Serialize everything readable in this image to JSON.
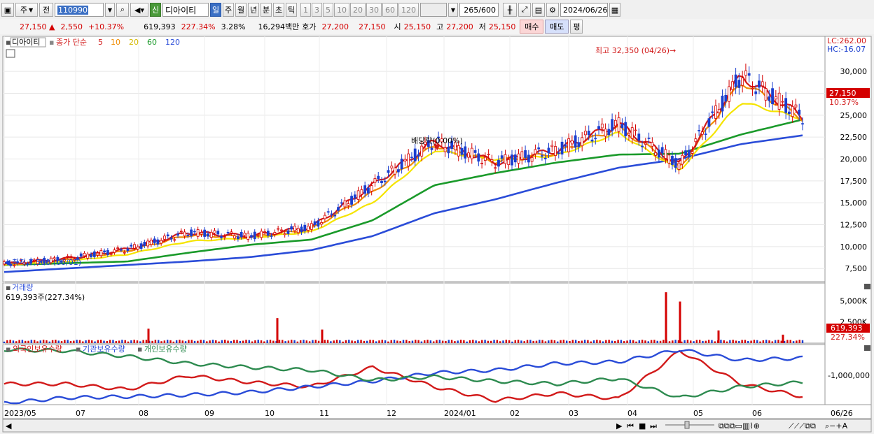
{
  "toolbar": {
    "mode_label": "주",
    "prev_label": "전",
    "code": "110990",
    "shin_label": "신",
    "stock_name": "디아이티",
    "periods": [
      "일",
      "주",
      "월",
      "년",
      "분",
      "초",
      "틱"
    ],
    "period_selected": "일",
    "intervals": [
      "1",
      "3",
      "5",
      "10",
      "20",
      "30",
      "60",
      "120"
    ],
    "count": "265",
    "count_total": "/600",
    "date": "2024/06/26"
  },
  "quote": {
    "price": "27,150",
    "change": "2,550",
    "change_pct": "+10.37%",
    "volume": "619,393",
    "volume_ratio": "227.34%",
    "turnover": "3.28%",
    "amount": "16,294백만",
    "bid_label": "호가",
    "bid1": "27,200",
    "bid2": "27,150",
    "open_label": "시",
    "open": "25,150",
    "high_label": "고",
    "high": "27,200",
    "low_label": "저",
    "low": "25,150",
    "buy_label": "매수",
    "sell_label": "매도",
    "eval_label": "평"
  },
  "price_panel": {
    "stock_tag": "디아이티",
    "ma_title": "종가 단순",
    "ma_periods": [
      "5",
      "10",
      "20",
      "60",
      "120"
    ],
    "ma_colors": [
      "#d21a1a",
      "#f08c00",
      "#f5e400",
      "#1a9a2a",
      "#2a4cd8"
    ],
    "lc": "LC:262.00",
    "hc": "HC:-16.07",
    "high_note": "최고 32,350 (04/26)",
    "low_note": "최저 7,500 (06/01)",
    "dividend_note": "배당락(0.00%)",
    "last_tag": "27,150",
    "last_pct": "10.37%"
  },
  "volume_panel": {
    "title": "거래량",
    "info": "619,393주(227.34%)",
    "last_tag": "619,393",
    "last_pct": "227.34%"
  },
  "holding_panel": {
    "legend": [
      "외국인보유수량",
      "기관보유수량",
      "개인보유수량"
    ],
    "colors": [
      "#d21a1a",
      "#2a4cd8",
      "#2e8b50"
    ]
  },
  "x_axis": {
    "labels": [
      "2023/05",
      "07",
      "08",
      "09",
      "10",
      "11",
      "12",
      "2024/01",
      "02",
      "03",
      "04",
      "05",
      "06"
    ],
    "right_label": "06/26"
  },
  "chart_data": [
    {
      "type": "candlestick",
      "title": "",
      "x": [
        "2023/05",
        "2023/06",
        "2023/07",
        "2023/08",
        "2023/09",
        "2023/10",
        "2023/11",
        "2023/12",
        "2024/01",
        "2024/02",
        "2024/03",
        "2024/04",
        "2024/05",
        "2024/06"
      ],
      "ylim": [
        6000,
        34000
      ],
      "yticks": [
        7500,
        10000,
        12500,
        15000,
        17500,
        20000,
        22500,
        25000,
        27500,
        30000
      ],
      "series": [
        {
          "name": "5",
          "values": [
            8000,
            8600,
            9700,
            11600,
            11200,
            12200,
            17000,
            22000,
            19600,
            21000,
            24000,
            19300,
            29500,
            24800
          ]
        },
        {
          "name": "10",
          "values": [
            7950,
            8500,
            9500,
            11300,
            11100,
            12000,
            16200,
            21600,
            19700,
            20700,
            23600,
            19000,
            28800,
            24600
          ]
        },
        {
          "name": "20",
          "values": [
            7900,
            8300,
            9100,
            10600,
            11000,
            11700,
            15000,
            21000,
            19900,
            20400,
            23000,
            18700,
            26500,
            24600
          ]
        },
        {
          "name": "60",
          "values": [
            7900,
            8100,
            8300,
            9300,
            10200,
            10800,
            13000,
            17000,
            18400,
            19600,
            20500,
            20600,
            22800,
            24500
          ]
        },
        {
          "name": "120",
          "values": [
            7100,
            7500,
            7900,
            8300,
            8800,
            9600,
            11200,
            13800,
            15400,
            17300,
            19000,
            20000,
            21700,
            22700
          ]
        }
      ],
      "annotations": [
        {
          "text": "최고 32,350 (04/26)",
          "value": 32350
        },
        {
          "text": "최저 7,500 (06/01)",
          "value": 7500
        },
        {
          "text": "배당락(0.00%)"
        }
      ]
    },
    {
      "type": "bar",
      "title": "거래량",
      "ylim": [
        0,
        7000000
      ],
      "yticks": [
        2500000,
        5000000
      ],
      "last": 619393,
      "spikes": [
        {
          "period": "2023/08",
          "value": 1700000
        },
        {
          "period": "2023/10",
          "value": 2950000
        },
        {
          "period": "2023/11",
          "value": 1600000
        },
        {
          "period": "2024/04",
          "value": 6000000
        },
        {
          "period": "2024/04",
          "value": 4900000
        },
        {
          "period": "2024/05",
          "value": 1500000
        },
        {
          "period": "2024/06",
          "value": 1000000
        }
      ]
    },
    {
      "type": "line",
      "title": "보유수량",
      "yticks": [
        -1000000
      ],
      "series": [
        {
          "name": "외국인보유수량",
          "values": [
            0.35,
            0.35,
            0.25,
            0.5,
            0.38,
            0.3,
            0.65,
            0.3,
            0.05,
            0.18,
            0.08,
            0.95,
            0.35,
            0.12
          ]
        },
        {
          "name": "기관보유수량",
          "values": [
            0.0,
            0.1,
            0.12,
            0.15,
            0.2,
            0.3,
            0.4,
            0.55,
            0.6,
            0.72,
            0.75,
            0.97,
            0.78,
            0.82
          ]
        },
        {
          "name": "개인보유수량",
          "values": [
            0.97,
            0.95,
            0.85,
            0.72,
            0.65,
            0.6,
            0.42,
            0.48,
            0.4,
            0.35,
            0.45,
            0.1,
            0.3,
            0.38
          ]
        }
      ]
    }
  ]
}
